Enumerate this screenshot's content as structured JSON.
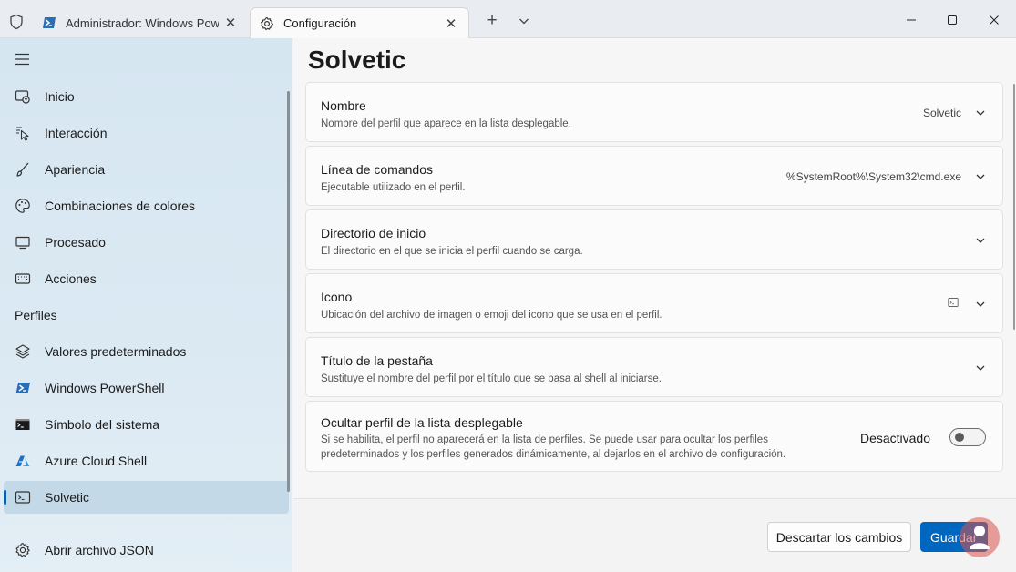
{
  "titlebar": {
    "tabs": [
      {
        "title": "Administrador: Windows Powe",
        "icon": "powershell-icon"
      },
      {
        "title": "Configuración",
        "icon": "gear-icon"
      }
    ],
    "close_glyph": "✕",
    "new_tab_glyph": "+"
  },
  "sidebar": {
    "items": [
      {
        "label": "Inicio",
        "icon": "startup-icon"
      },
      {
        "label": "Interacción",
        "icon": "pointer-icon"
      },
      {
        "label": "Apariencia",
        "icon": "brush-icon"
      },
      {
        "label": "Combinaciones de colores",
        "icon": "palette-icon"
      },
      {
        "label": "Procesado",
        "icon": "monitor-icon"
      },
      {
        "label": "Acciones",
        "icon": "keyboard-icon"
      }
    ],
    "profiles_header": "Perfiles",
    "profiles": [
      {
        "label": "Valores predeterminados",
        "icon": "layers-icon"
      },
      {
        "label": "Windows PowerShell",
        "icon": "powershell-icon"
      },
      {
        "label": "Símbolo del sistema",
        "icon": "cmd-icon"
      },
      {
        "label": "Azure Cloud Shell",
        "icon": "azure-icon"
      },
      {
        "label": "Solvetic",
        "icon": "terminal-icon",
        "selected": true
      }
    ],
    "open_json": "Abrir archivo JSON"
  },
  "main": {
    "title": "Solvetic",
    "settings": [
      {
        "title": "Nombre",
        "desc": "Nombre del perfil que aparece en la lista desplegable.",
        "value": "Solvetic"
      },
      {
        "title": "Línea de comandos",
        "desc": "Ejecutable utilizado en el perfil.",
        "value": "%SystemRoot%\\System32\\cmd.exe"
      },
      {
        "title": "Directorio de inicio",
        "desc": "El directorio en el que se inicia el perfil cuando se carga.",
        "value": ""
      },
      {
        "title": "Icono",
        "desc": "Ubicación del archivo de imagen o emoji del icono que se usa en el perfil.",
        "value_icon": "terminal-icon"
      },
      {
        "title": "Título de la pestaña",
        "desc": "Sustituye el nombre del perfil por el título que se pasa al shell al iniciarse.",
        "value": ""
      },
      {
        "title": "Ocultar perfil de la lista desplegable",
        "desc": "Si se habilita, el perfil no aparecerá en la lista de perfiles. Se puede usar para ocultar los perfiles predeterminados y los perfiles generados dinámicamente, al dejarlos en el archivo de configuración.",
        "toggle_label": "Desactivado",
        "toggle_on": false
      }
    ],
    "discard_label": "Descartar los cambios",
    "save_label": "Guardar"
  },
  "colors": {
    "accent": "#0067c0",
    "selection": "#c4d9e8"
  }
}
